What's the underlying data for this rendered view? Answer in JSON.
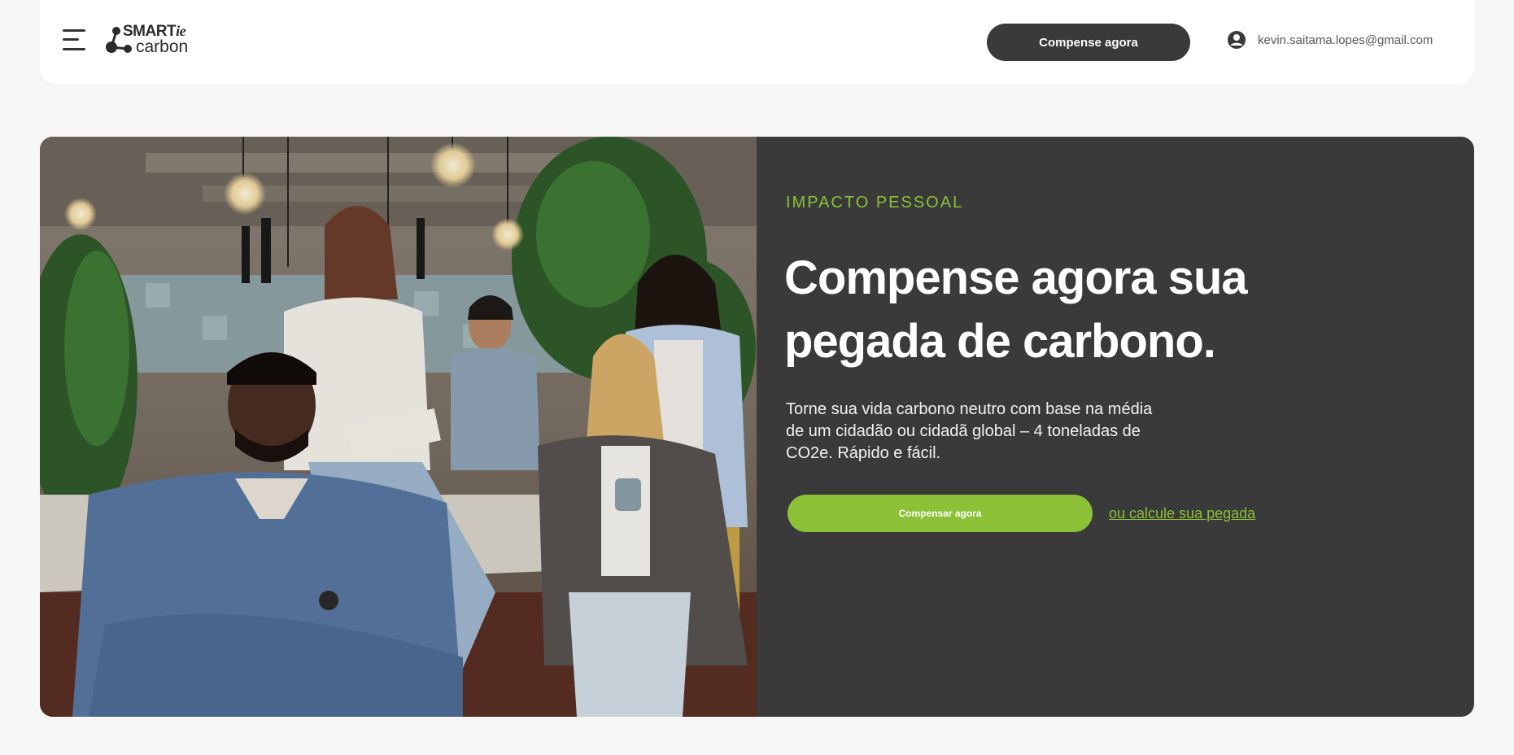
{
  "header": {
    "logo": {
      "brand_top": "SMART",
      "brand_suffix": "ie",
      "brand_bottom": "carbon"
    },
    "cta_label": "Compense agora",
    "account_email": "kevin.saitama.lopes@gmail.com"
  },
  "hero": {
    "eyebrow": "IMPACTO PESSOAL",
    "headline_line1": "Compense agora sua",
    "headline_line2": "pegada de carbono.",
    "description_line1": "Torne sua vida carbono neutro com base na média",
    "description_line2": "de um cidadão ou cidadã global – 4 toneladas de",
    "description_line3": "CO2e. Rápido e fácil.",
    "primary_cta": "Compensar agora",
    "secondary_link": "ou calcule sua pegada"
  },
  "colors": {
    "accent": "#8cc036",
    "dark": "#3a3a3a",
    "background": "#f6f6f6"
  },
  "icons": [
    "menu-icon",
    "logo-molecule-icon",
    "user-account-icon"
  ]
}
